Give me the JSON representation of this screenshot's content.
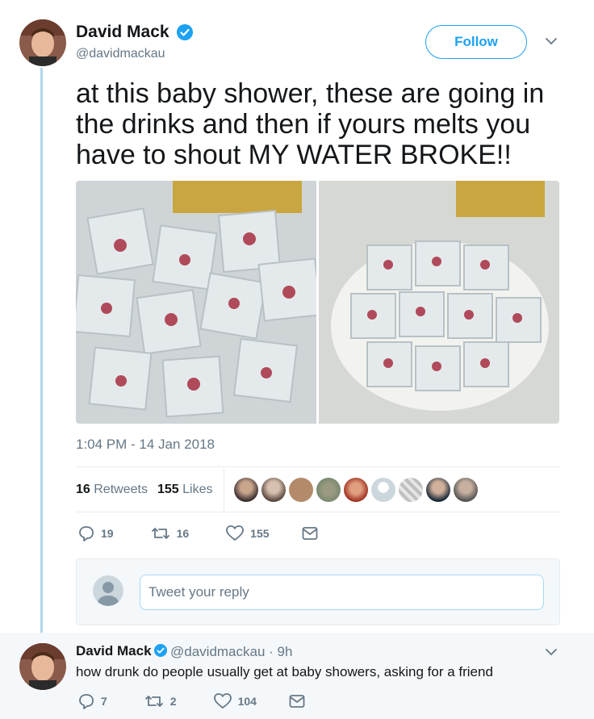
{
  "tweet": {
    "author_name": "David Mack",
    "author_handle": "@davidmackau",
    "follow_label": "Follow",
    "text": "at this baby shower, these are going in the drinks and then if yours melts you have to shout MY WATER BROKE!!",
    "timestamp": "1:04 PM - 14 Jan 2018",
    "retweets_count": "16",
    "retweets_label": "Retweets",
    "likes_count": "155",
    "likes_label": "Likes",
    "actions": {
      "reply_count": "19",
      "retweet_count": "16",
      "like_count": "155"
    },
    "reply_placeholder": "Tweet your reply"
  },
  "reply_tweet": {
    "author_name": "David Mack",
    "author_handle_time": "@davidmackau · 9h",
    "text": "how drunk do people usually get at baby showers, asking for a friend",
    "actions": {
      "reply_count": "7",
      "retweet_count": "2",
      "like_count": "104"
    }
  },
  "likers_avatars": [
    "face-1",
    "face-2",
    "face-3",
    "face-4",
    "face-5",
    "face-6",
    "face-7",
    "face-8",
    "face-9"
  ],
  "colors": {
    "accent": "#1da1f2",
    "verified": "#1da1f2",
    "thread_line": "#b1d6ee",
    "muted": "#657786",
    "like_icon": "#657786"
  }
}
